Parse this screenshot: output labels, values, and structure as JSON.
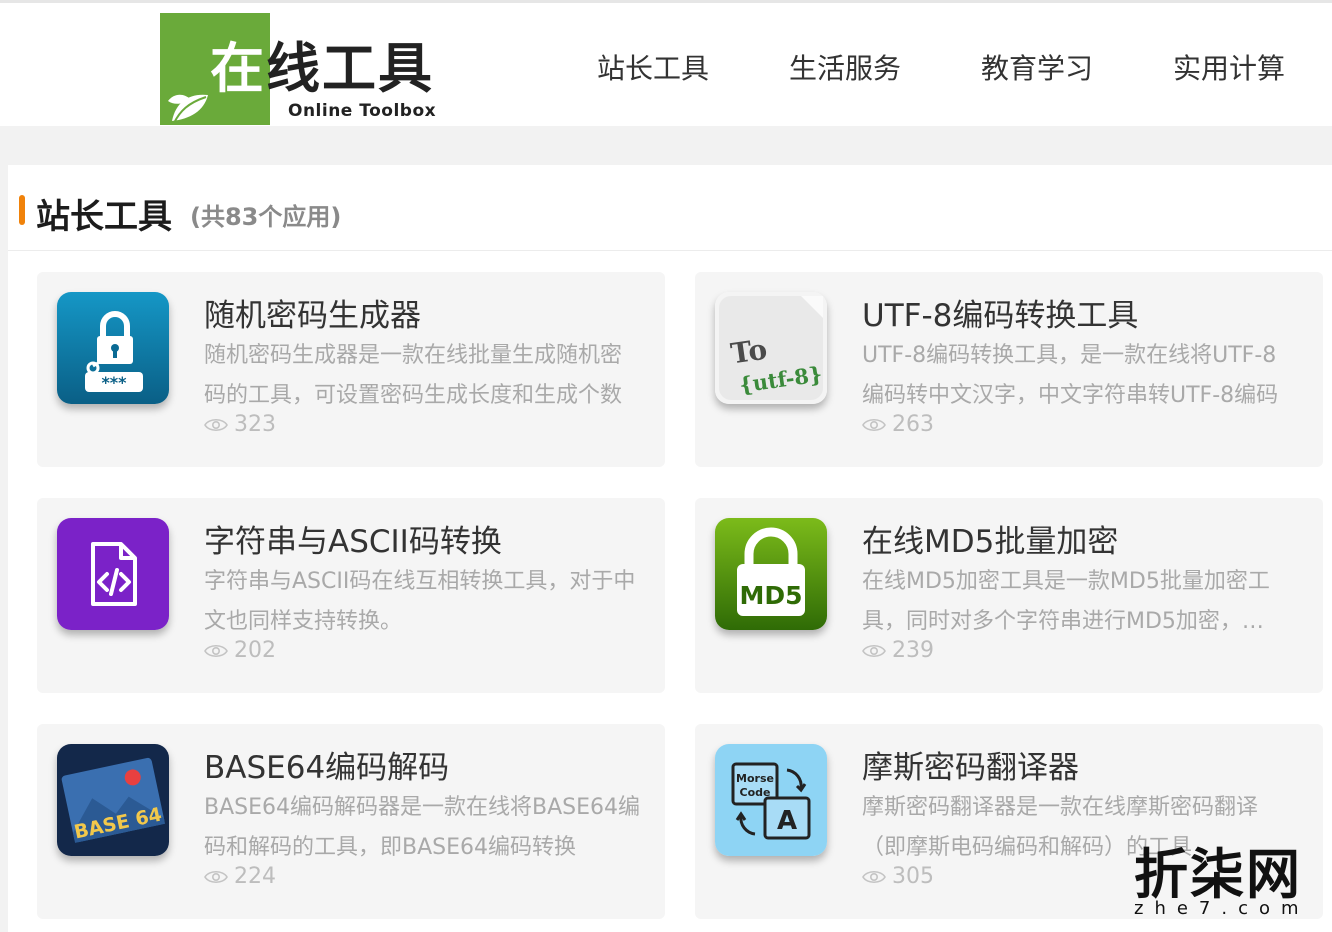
{
  "logo": {
    "name": "在线工具",
    "name_first": "在",
    "name_rest": "线工具",
    "subtitle": "Online Toolbox"
  },
  "nav": {
    "items": [
      {
        "label": "站长工具"
      },
      {
        "label": "生活服务"
      },
      {
        "label": "教育学习"
      },
      {
        "label": "实用计算"
      }
    ]
  },
  "section": {
    "title": "站长工具",
    "count": "(共83个应用)",
    "accent_color": "#f0820a"
  },
  "cards": [
    {
      "title": "随机密码生成器",
      "desc": "随机密码生成器是一款在线批量生成随机密码的工具，可设置密码生成长度和生成个数",
      "views": "323",
      "icon": "lock-password-icon"
    },
    {
      "title": "UTF-8编码转换工具",
      "desc": "UTF-8编码转换工具，是一款在线将UTF-8编码转中文汉字，中文字符串转UTF-8编码",
      "views": "263",
      "icon": "utf8-convert-icon",
      "icon_text_to": "To",
      "icon_text_utf": "{utf-8}"
    },
    {
      "title": "字符串与ASCII码转换",
      "desc": "字符串与ASCII码在线互相转换工具，对于中文也同样支持转换。",
      "views": "202",
      "icon": "code-file-icon"
    },
    {
      "title": "在线MD5批量加密",
      "desc": "在线MD5加密工具是一款MD5批量加密工具，同时对多个字符串进行MD5加密，…",
      "views": "239",
      "icon": "md5-lock-icon",
      "icon_text": "MD5"
    },
    {
      "title": "BASE64编码解码",
      "desc": "BASE64编码解码器是一款在线将BASE64编码和解码的工具，即BASE64编码转换",
      "views": "224",
      "icon": "base64-image-icon",
      "icon_text": "BASE 64"
    },
    {
      "title": "摩斯密码翻译器",
      "desc": "摩斯密码翻译器是一款在线摩斯密码翻译（即摩斯电码编码和解码）的工具",
      "views": "305",
      "icon": "morse-translate-icon",
      "icon_text_morse": "Morse",
      "icon_text_code": "Code",
      "icon_text_a": "A"
    }
  ],
  "watermark": {
    "name": "折柒网",
    "url": "zhe7.com"
  }
}
